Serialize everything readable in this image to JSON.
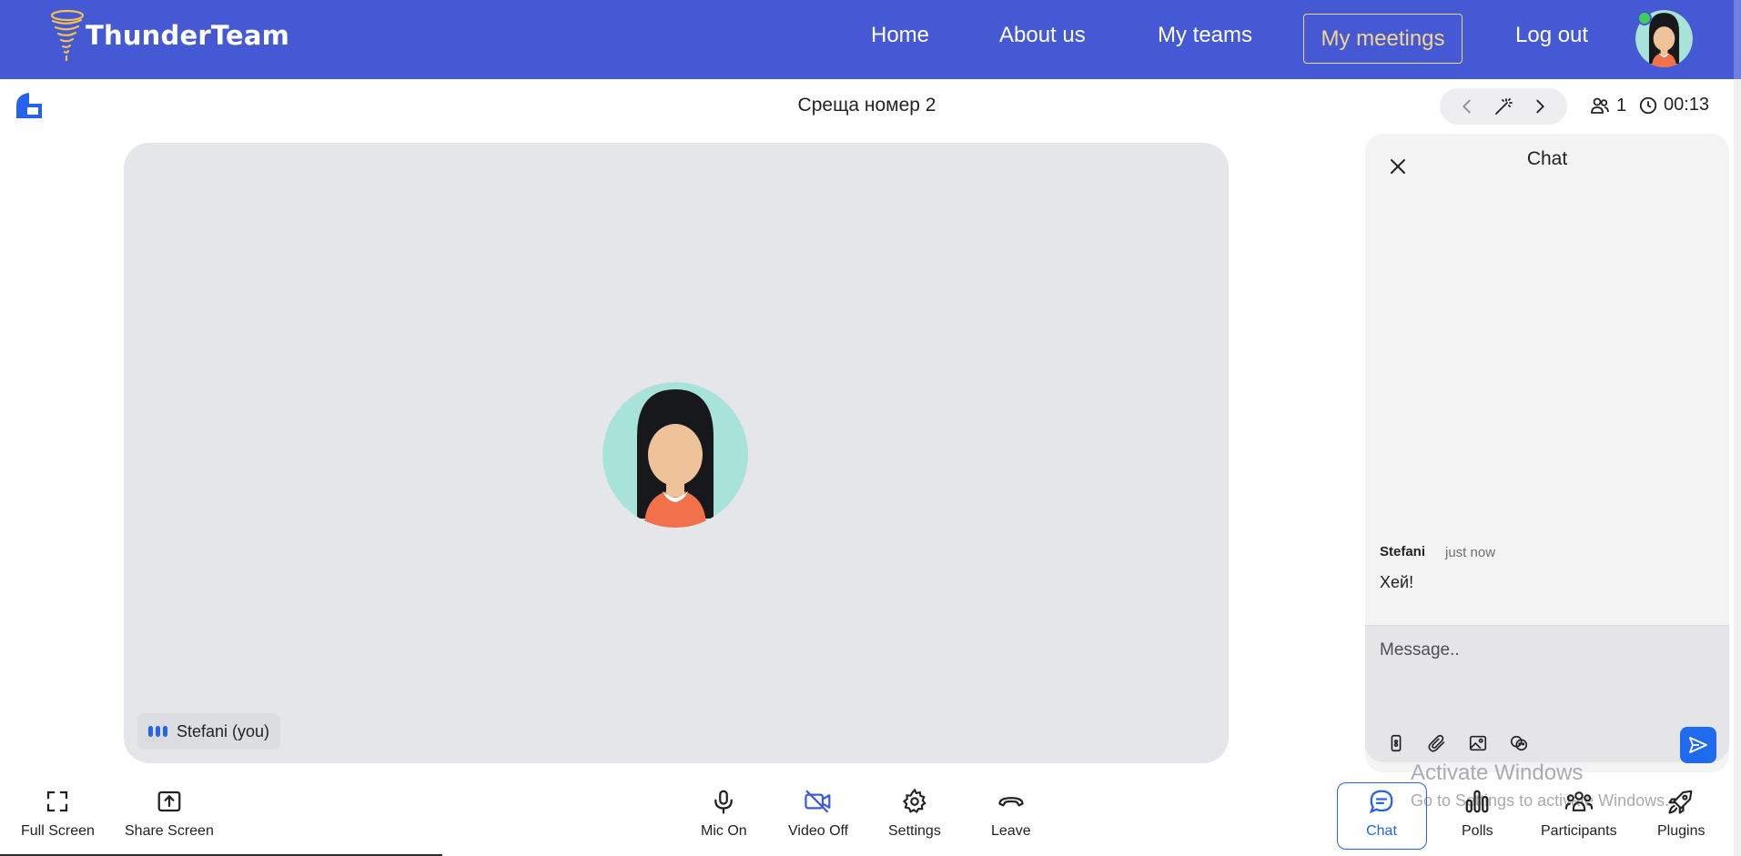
{
  "nav": {
    "brand": "ThunderTeam",
    "links": [
      "Home",
      "About us",
      "My teams"
    ],
    "active": "My meetings",
    "logout": "Log out"
  },
  "meeting": {
    "title": "Среща номер 2",
    "participants_count": "1",
    "timer": "00:13"
  },
  "stage": {
    "participant_name": "Stefani (you)"
  },
  "chat": {
    "title": "Chat",
    "messages": [
      {
        "author": "Stefani",
        "time": "just now",
        "text": "Хей!"
      }
    ],
    "placeholder": "Message.."
  },
  "toolbar": {
    "full_screen": "Full Screen",
    "share_screen": "Share Screen",
    "mic": "Mic On",
    "video": "Video Off",
    "settings": "Settings",
    "leave": "Leave",
    "chat": "Chat",
    "polls": "Polls",
    "participants": "Participants",
    "plugins": "Plugins"
  },
  "watermark": {
    "line1": "Activate Windows",
    "line2": "Go to Settings to activate Windows."
  },
  "colors": {
    "nav_bg": "#4559d4",
    "accent": "#2563eb",
    "active_link": "#f4d58d",
    "online": "#3ccf5a"
  }
}
